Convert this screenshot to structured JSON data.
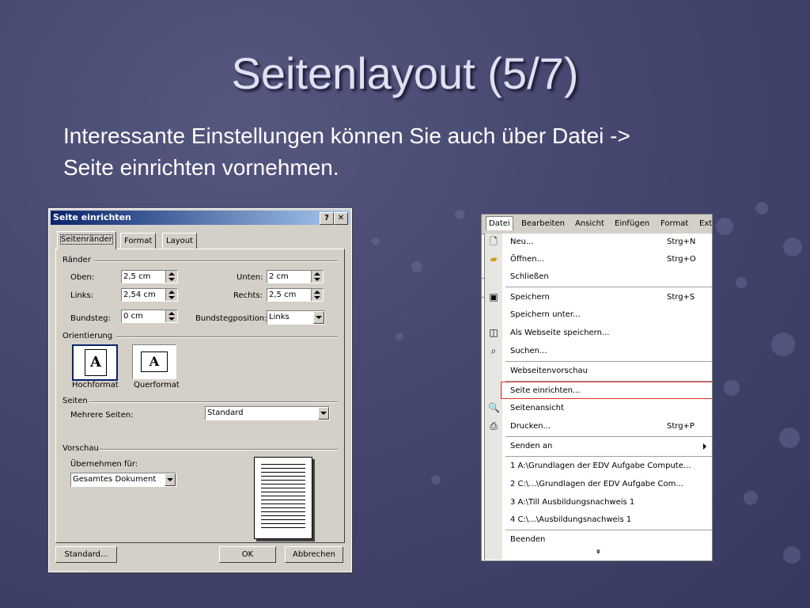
{
  "slide": {
    "title": "Seitenlayout (5/7)",
    "subtitle_line1": "Interessante Einstellungen können Sie auch über Datei ->",
    "subtitle_line2": "Seite einrichten vornehmen."
  },
  "dialog": {
    "title": "Seite einrichten",
    "help_btn": "?",
    "close_btn": "✕",
    "tabs": [
      "Seitenränder",
      "Format",
      "Layout"
    ],
    "sections": {
      "margins": "Ränder",
      "orientation": "Orientierung",
      "pages": "Seiten",
      "preview": "Vorschau"
    },
    "fields": {
      "top_label": "Oben:",
      "top_value": "2,5 cm",
      "bottom_label": "Unten:",
      "bottom_value": "2 cm",
      "left_label": "Links:",
      "left_value": "2,54 cm",
      "right_label": "Rechts:",
      "right_value": "2,5 cm",
      "gutter_label": "Bundsteg:",
      "gutter_value": "0 cm",
      "gutter_pos_label": "Bundstegposition:",
      "gutter_pos_value": "Links",
      "multiple_pages_label": "Mehrere Seiten:",
      "multiple_pages_value": "Standard",
      "apply_label": "Übernehmen für:",
      "apply_value": "Gesamtes Dokument"
    },
    "orientation": {
      "portrait_label": "Hochformat",
      "landscape_label": "Querformat",
      "glyph": "A"
    },
    "buttons": {
      "default": "Standard...",
      "ok": "OK",
      "cancel": "Abbrechen"
    }
  },
  "filemenu": {
    "menubar": [
      "Datei",
      "Bearbeiten",
      "Ansicht",
      "Einfügen",
      "Format",
      "Ext"
    ],
    "items": [
      {
        "label": "Neu...",
        "shortcut": "Strg+N",
        "icon": "new-document-icon"
      },
      {
        "label": "Öffnen...",
        "shortcut": "Strg+O",
        "icon": "open-folder-icon"
      },
      {
        "label": "Schließen",
        "shortcut": "",
        "icon": ""
      },
      {
        "label": "Speichern",
        "shortcut": "Strg+S",
        "icon": "save-disk-icon"
      },
      {
        "label": "Speichern unter...",
        "shortcut": "",
        "icon": ""
      },
      {
        "label": "Als Webseite speichern...",
        "shortcut": "",
        "icon": "web-save-icon"
      },
      {
        "label": "Suchen...",
        "shortcut": "",
        "icon": "search-icon"
      },
      {
        "label": "Webseitenvorschau",
        "shortcut": "",
        "icon": ""
      },
      {
        "label": "Seite einrichten...",
        "shortcut": "",
        "icon": ""
      },
      {
        "label": "Seitenansicht",
        "shortcut": "",
        "icon": "print-preview-icon"
      },
      {
        "label": "Drucken...",
        "shortcut": "Strg+P",
        "icon": "printer-icon"
      },
      {
        "label": "Senden an",
        "shortcut": "",
        "icon": ""
      },
      {
        "label": "1 A:\\Grundlagen der EDV Aufgabe Compute...",
        "shortcut": "",
        "icon": ""
      },
      {
        "label": "2 C:\\...\\Grundlagen der EDV Aufgabe Com...",
        "shortcut": "",
        "icon": ""
      },
      {
        "label": "3 A:\\Till Ausbildungsnachweis 1",
        "shortcut": "",
        "icon": ""
      },
      {
        "label": "4 C:\\...\\Ausbildungsnachweis 1",
        "shortcut": "",
        "icon": ""
      },
      {
        "label": "Beenden",
        "shortcut": "",
        "icon": ""
      }
    ],
    "expand": "»"
  }
}
